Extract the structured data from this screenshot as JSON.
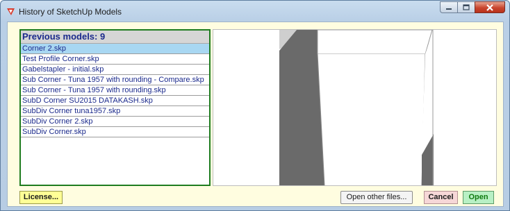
{
  "window": {
    "title": "History of SketchUp Models",
    "app_icon": "sketchup-logo-icon",
    "controls": [
      "minimize-icon",
      "maximize-icon",
      "close-icon"
    ]
  },
  "models_list": {
    "header": "Previous models: 9",
    "items": [
      "Corner 2.skp",
      "Test Profile Corner.skp",
      "Gabelstapler - initial.skp",
      "Sub Corner - Tuna 1957 with rounding - Compare.skp",
      "Sub Corner - Tuna 1957 with rounding.skp",
      "SubD Corner SU2015 DATAKASH.skp",
      "SubDiv Corner tuna1957.skp",
      "SubDiv Corner 2.skp",
      "SubDiv Corner.skp"
    ],
    "selected_index": 0
  },
  "buttons": {
    "license": "License...",
    "open_other": "Open other files...",
    "cancel": "Cancel",
    "open": "Open"
  },
  "colors": {
    "panel_background": "#fffde0",
    "list_border": "#1f7c1f",
    "list_text": "#1b2a8c",
    "selection": "#a8d7f2",
    "license_button": "#ffff96",
    "cancel_button": "#f6d7d7",
    "open_button": "#b8f0c4"
  }
}
